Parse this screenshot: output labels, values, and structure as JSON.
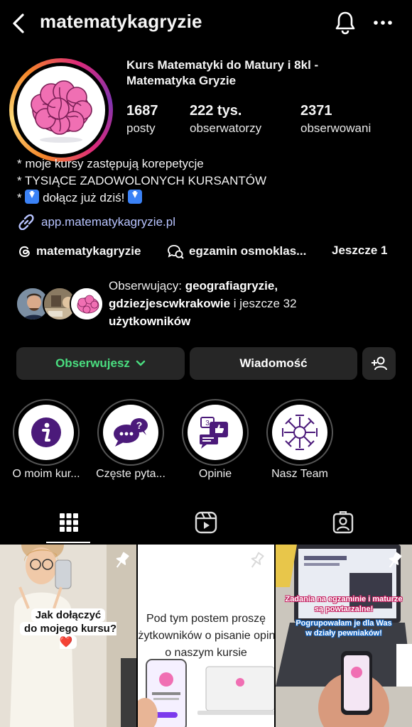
{
  "header": {
    "username": "matematykagryzie"
  },
  "profile": {
    "full_name_line1": "Kurs Matematyki do Matury i 8kl -",
    "full_name_line2": "Matematyka Gryzie",
    "stats": [
      {
        "value": "1687",
        "label": "posty"
      },
      {
        "value": "222 tys.",
        "label": "obserwatorzy"
      },
      {
        "value": "2371",
        "label": "obserwowani"
      }
    ],
    "bio": [
      "* moje kursy zastępują korepetycje",
      "* TYSIĄCE ZADOWOLONYCH KURSANTÓW",
      "* ",
      " dołącz już dziś! "
    ],
    "link": "app.matematykagryzie.pl",
    "threads_handle": "matematykagryzie",
    "channel": "egzamin osmoklas...",
    "more": "Jeszcze 1",
    "followers": {
      "prefix": "Obserwujący: ",
      "name1": "geografiagryzie,",
      "name2": "gdziezjescwkrakowie",
      "suffix_and": " i ",
      "suffix_rest": "jeszcze 32",
      "last": "użytkowników"
    }
  },
  "actions": {
    "follow_label": "Obserwujesz",
    "message_label": "Wiadomość",
    "colors": {
      "follow": "#4ade80",
      "button_bg": "#262626"
    }
  },
  "highlights": [
    {
      "label": "O moim kur...",
      "icon": "info-icon"
    },
    {
      "label": "Częste pyta...",
      "icon": "faq-chat-icon"
    },
    {
      "label": "Opinie",
      "icon": "reviews-icon"
    },
    {
      "label": "Nasz Team",
      "icon": "team-icon"
    }
  ],
  "tabs": [
    {
      "name": "grid-icon",
      "active": true
    },
    {
      "name": "reels-icon",
      "active": false
    },
    {
      "name": "tagged-icon",
      "active": false
    }
  ],
  "posts": [
    {
      "text_line1": "Jak dołączyć",
      "text_line2": "do mojego kursu? ❤️"
    },
    {
      "text_line1": "Pod tym postem proszę",
      "text_line2": "użytkowników o pisanie opinii",
      "text_line3": "o naszym kursie"
    },
    {
      "text_line1": "Zadania na egzaminie i maturze",
      "text_line2": "są powtarzalne!",
      "text_line3": "Pogrupowałam je dla Was",
      "text_line4": "w działy pewniaków!"
    }
  ]
}
